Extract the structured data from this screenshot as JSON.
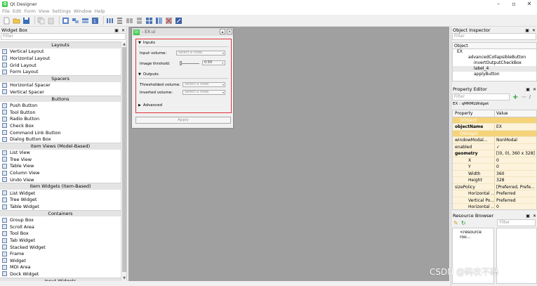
{
  "app": {
    "title": "Qt Designer"
  },
  "menu": [
    "File",
    "Edit",
    "Form",
    "View",
    "Settings",
    "Window",
    "Help"
  ],
  "widget_box": {
    "title": "Widget Box",
    "filter_placeholder": "Filter",
    "groups": [
      {
        "name": "Layouts",
        "items": [
          "Vertical Layout",
          "Horizontal Layout",
          "Grid Layout",
          "Form Layout"
        ]
      },
      {
        "name": "Spacers",
        "items": [
          "Horizontal Spacer",
          "Vertical Spacer"
        ]
      },
      {
        "name": "Buttons",
        "items": [
          "Push Button",
          "Tool Button",
          "Radio Button",
          "Check Box",
          "Command Link Button",
          "Dialog Button Box"
        ]
      },
      {
        "name": "Item Views (Model-Based)",
        "items": [
          "List View",
          "Tree View",
          "Table View",
          "Column View",
          "Undo View"
        ]
      },
      {
        "name": "Item Widgets (Item-Based)",
        "items": [
          "List Widget",
          "Tree Widget",
          "Table Widget"
        ]
      },
      {
        "name": "Containers",
        "items": [
          "Group Box",
          "Scroll Area",
          "Tool Box",
          "Tab Widget",
          "Stacked Widget",
          "Frame",
          "Widget",
          "MDI Area",
          "Dock Widget"
        ]
      },
      {
        "name": "Input Widgets",
        "items": []
      }
    ]
  },
  "form": {
    "title": "- EX.ui",
    "inputs_label": "Inputs",
    "input_volume_label": "Input volume:",
    "input_volume_placeholder": "Select a node",
    "image_threshold_label": "Image thrshold:",
    "image_threshold_value": "0.50",
    "outputs_label": "Outputs",
    "thresholded_volume_label": "Thresholded volume:",
    "thresholded_volume_placeholder": "Select a node",
    "inverted_volume_label": "Inverted volume:",
    "inverted_volume_placeholder": "Select a node",
    "advanced_label": "Advanced",
    "apply_label": "Apply"
  },
  "object_inspector": {
    "title": "Object Inspector",
    "filter_placeholder": "Filter",
    "header": "Object",
    "tree": [
      "EX",
      "advancedCollapsibleButton",
      "invertOutputCheckBox",
      "label_4",
      "applyButton"
    ]
  },
  "property_editor": {
    "title": "Property Editor",
    "filter_placeholder": "Filter",
    "object_line": "EX : qMRMLWidget",
    "col_property": "Property",
    "col_value": "Value",
    "rows": [
      {
        "name": "QObject",
        "value": "",
        "kind": "section"
      },
      {
        "name": "objectName",
        "value": "EX",
        "kind": "bold"
      },
      {
        "name": "QWidget",
        "value": "",
        "kind": "section"
      },
      {
        "name": "windowModal...",
        "value": "NonModal",
        "kind": "normal"
      },
      {
        "name": "enabled",
        "value": "✓",
        "kind": "normal"
      },
      {
        "name": "geometry",
        "value": "[(0, 0), 360 x 328]",
        "kind": "bold"
      },
      {
        "name": "X",
        "value": "0",
        "kind": "sub"
      },
      {
        "name": "Y",
        "value": "0",
        "kind": "sub"
      },
      {
        "name": "Width",
        "value": "360",
        "kind": "sub"
      },
      {
        "name": "Height",
        "value": "328",
        "kind": "sub"
      },
      {
        "name": "sizePolicy",
        "value": "[Preferred, Prefe...",
        "kind": "normal"
      },
      {
        "name": "Horizontal ...",
        "value": "Preferred",
        "kind": "sub"
      },
      {
        "name": "Vertical Po...",
        "value": "Preferred",
        "kind": "sub"
      },
      {
        "name": "Horizontal ...",
        "value": "0",
        "kind": "sub"
      }
    ]
  },
  "resource_browser": {
    "title": "Resource Browser",
    "filter_placeholder": "Filter",
    "root": "<resource roo..."
  },
  "watermark": "CSDN @码农不码",
  "colors": {
    "accent_green": "#41cd52",
    "highlight_red": "#e0303a",
    "prop_section": "#f5d37a",
    "prop_row": "#fdf3dc"
  }
}
